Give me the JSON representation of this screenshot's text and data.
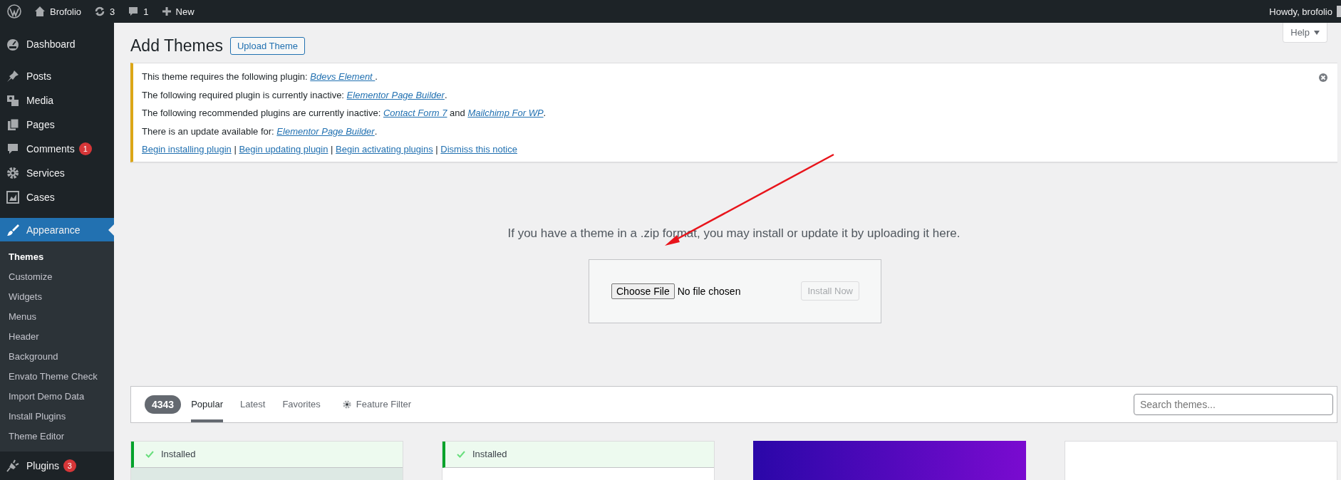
{
  "admin_bar": {
    "site_name": "Brofolio",
    "updates": "3",
    "comments": "1",
    "new": "New",
    "greeting": "Howdy, brofolio"
  },
  "sidebar": {
    "items": [
      {
        "kind": "dashboard",
        "label": "Dashboard",
        "selected": false
      },
      {
        "kind": "pin",
        "label": "Posts",
        "selected": false
      },
      {
        "kind": "media",
        "label": "Media",
        "selected": false
      },
      {
        "kind": "pages",
        "label": "Pages",
        "selected": false
      },
      {
        "kind": "comment",
        "label": "Comments",
        "badge": "1",
        "selected": false
      },
      {
        "kind": "gear",
        "label": "Services",
        "selected": false
      },
      {
        "kind": "image",
        "label": "Cases",
        "selected": false
      },
      {
        "kind": "brush",
        "label": "Appearance",
        "selected": true,
        "children": [
          {
            "label": "Themes",
            "selected": true
          },
          {
            "label": "Customize",
            "selected": false
          },
          {
            "label": "Widgets",
            "selected": false
          },
          {
            "label": "Menus",
            "selected": false
          },
          {
            "label": "Header",
            "selected": false
          },
          {
            "label": "Background",
            "selected": false
          },
          {
            "label": "Envato Theme Check",
            "selected": false
          },
          {
            "label": "Import Demo Data",
            "selected": false
          },
          {
            "label": "Install Plugins",
            "selected": false
          },
          {
            "label": "Theme Editor",
            "selected": false
          }
        ]
      },
      {
        "kind": "plug",
        "label": "Plugins",
        "badge": "3",
        "selected": false
      }
    ]
  },
  "page": {
    "title": "Add Themes",
    "upload_button": "Upload Theme",
    "help": "Help"
  },
  "notice": {
    "lines": [
      [
        {
          "kind": "text",
          "text": "This theme requires the following plugin: "
        },
        {
          "kind": "link",
          "text": "Bdevs Element "
        },
        {
          "kind": "text",
          "text": "."
        }
      ],
      [
        {
          "kind": "text",
          "text": "The following required plugin is currently inactive: "
        },
        {
          "kind": "link",
          "text": "Elementor Page Builder"
        },
        {
          "kind": "text",
          "text": "."
        }
      ],
      [
        {
          "kind": "text",
          "text": "The following recommended plugins are currently inactive: "
        },
        {
          "kind": "link",
          "text": "Contact Form 7"
        },
        {
          "kind": "text",
          "text": " and "
        },
        {
          "kind": "link",
          "text": "Mailchimp For WP"
        },
        {
          "kind": "text",
          "text": "."
        }
      ],
      [
        {
          "kind": "text",
          "text": "There is an update available for: "
        },
        {
          "kind": "link",
          "text": "Elementor Page Builder"
        },
        {
          "kind": "text",
          "text": "."
        }
      ]
    ],
    "actions": [
      {
        "kind": "link",
        "text": "Begin installing plugin"
      },
      {
        "kind": "separator",
        "text": "|"
      },
      {
        "kind": "link",
        "text": "Begin updating plugin"
      },
      {
        "kind": "separator",
        "text": "|"
      },
      {
        "kind": "link",
        "text": "Begin activating plugins"
      },
      {
        "kind": "separator",
        "text": "|"
      },
      {
        "kind": "link",
        "text": "Dismiss this notice"
      }
    ]
  },
  "upload": {
    "message": "If you have a theme in a .zip format, you may install or update it by uploading it here.",
    "choose_file": "Choose File",
    "file_status": "No file chosen",
    "install_button": "Install Now",
    "install_disabled": true
  },
  "filter": {
    "count": "4343",
    "tabs": [
      {
        "label": "Popular",
        "selected": true
      },
      {
        "label": "Latest",
        "selected": false
      },
      {
        "label": "Favorites",
        "selected": false
      }
    ],
    "feature_filter": "Feature Filter",
    "search": {
      "placeholder": "Search themes..."
    }
  },
  "themes": [
    {
      "installed": true,
      "status": "Installed"
    },
    {
      "installed": true,
      "status": "Installed"
    },
    {
      "installed": false
    },
    {
      "installed": false
    }
  ]
}
